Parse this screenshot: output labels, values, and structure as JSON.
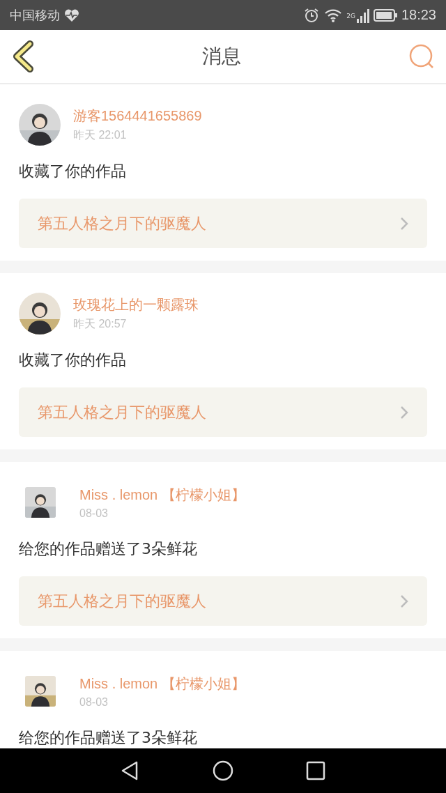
{
  "status_bar": {
    "carrier": "中国移动",
    "time": "18:23",
    "network": "2G"
  },
  "header": {
    "title": "消息"
  },
  "messages": [
    {
      "round_avatar": true,
      "name": "游客1564441655869",
      "time": "昨天 22:01",
      "text": "收藏了你的作品",
      "link": "第五人格之月下的驱魔人"
    },
    {
      "round_avatar": true,
      "name": "玫瑰花上的一颗露珠",
      "time": "昨天 20:57",
      "text": "收藏了你的作品",
      "link": "第五人格之月下的驱魔人"
    },
    {
      "round_avatar": false,
      "name": "Miss . lemon 【柠檬小姐】",
      "time": "08-03",
      "text": "给您的作品赠送了3朵鲜花",
      "link": "第五人格之月下的驱魔人"
    },
    {
      "round_avatar": false,
      "name": "Miss . lemon 【柠檬小姐】",
      "time": "08-03",
      "text": "给您的作品赠送了3朵鲜花"
    }
  ]
}
